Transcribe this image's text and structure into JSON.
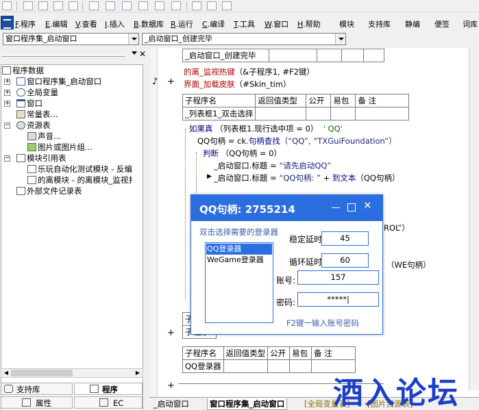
{
  "menu": [
    {
      "key": "F",
      "label": ".程序"
    },
    {
      "key": "E",
      "label": ".编辑"
    },
    {
      "key": "V",
      "label": ".查看"
    },
    {
      "key": "I",
      "label": ".插入"
    },
    {
      "key": "B",
      "label": ".数据库"
    },
    {
      "key": "R",
      "label": ".运行"
    },
    {
      "key": "C",
      "label": ".编译"
    },
    {
      "key": "T",
      "label": ".工具"
    },
    {
      "key": "W",
      "label": ".窗口"
    },
    {
      "key": "H",
      "label": ".帮助"
    }
  ],
  "menu_extra": [
    "模块",
    "支持库",
    "静编",
    "便签",
    "词库"
  ],
  "combos": {
    "left": "窗口程序集_启动窗口",
    "right": "_启动窗口_创建完毕"
  },
  "tree": {
    "root": "程序数据",
    "items": [
      "窗口程序集_启动窗口",
      "全局变量",
      "窗口",
      "常量表...",
      "资源表",
      "声音...",
      "图片或图片组...",
      "模块引用表",
      "乐玩自动化测试模块 - 反编",
      "的离模块 - 的离模块_监视扌",
      "外部文件记录表"
    ]
  },
  "left_tabs": {
    "support": "支持库",
    "program": "程序",
    "property": "属性",
    "ec": "EC"
  },
  "editor": {
    "row_top": "_启动窗口_创建完毕",
    "line1_a": "的离_监视热键",
    "line1_b": "（&子程序1, #F2键）",
    "line2_a": "界面_加载皮肤",
    "line2_b": "（#Skin_tim）",
    "table1": {
      "headers": [
        "子程序名",
        "返回值类型",
        "公开",
        "易包",
        "备 注"
      ],
      "name": "_列表框1_双击选择"
    },
    "code": {
      "l1_kw": "如果真",
      "l1_expr": "（列表框1.现行选中项 = 0）",
      "l1_cmt": "' QQ'",
      "l2_a": "QQ句柄 = ck.",
      "l2_fn": "句柄查找",
      "l2_b": "（“QQ”, “TXGuiFoundation”）",
      "l3_kw": "判断",
      "l3_expr": "（QQ句柄 = 0）",
      "l4_a": "_启动窗口.标题 = ",
      "l4_s": "“请先启动QQ”",
      "l5_a": "_启动窗口.标题 = ",
      "l5_s": "“QQ句柄:  ”",
      "l5_b": " + ",
      "l5_fn": "到文本",
      "l5_c": "（QQ句柄）",
      "peek1": "ROL”）",
      "peek2": "（WE句柄）",
      "sub1": "子程",
      "sub2": "子程序1"
    },
    "table2": {
      "headers": [
        "子程序名",
        "返回值类型",
        "公开",
        "易包",
        "备 注"
      ],
      "name": "QQ登录器"
    }
  },
  "bottom_tabs": [
    "_启动窗口",
    "窗口程序集_启动窗口",
    "[全局变量表]",
    "[图片资源表]"
  ],
  "dialog": {
    "title": "QQ句柄:  2755214",
    "hint": "双击选择需要的登录器",
    "list": [
      "QQ登录器",
      "WeGame登录器"
    ],
    "stable_delay_label": "稳定延时",
    "stable_delay": "45",
    "loop_delay_label": "循环延时",
    "loop_delay": "60",
    "account_label": "账号:",
    "account": "157",
    "password_label": "密码:",
    "password": "*****|",
    "footer": "F2键一输入账号密码"
  },
  "watermark": "酒入论坛",
  "colors": {
    "dialog_accent": "#2b6ee0",
    "list_selection": "#2b6ee0",
    "watermark": "#1b3fc8",
    "keyword": "#00007f",
    "comment": "#007000"
  }
}
